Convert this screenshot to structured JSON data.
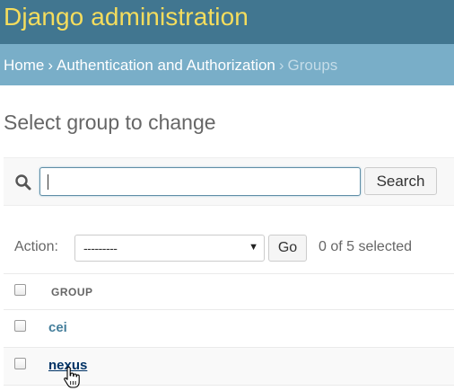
{
  "header": {
    "brand": "Django administration"
  },
  "breadcrumbs": {
    "items": [
      {
        "label": "Home",
        "link": true
      },
      {
        "label": "Authentication and Authorization",
        "link": true
      },
      {
        "label": "Groups",
        "link": false
      }
    ],
    "separator": "›"
  },
  "page": {
    "title": "Select group to change"
  },
  "search": {
    "value": "",
    "button_label": "Search",
    "icon": "search-icon"
  },
  "actions": {
    "label": "Action:",
    "selected_option": "---------",
    "go_label": "Go",
    "selected_count": "0 of 5 selected"
  },
  "results": {
    "column_header": "GROUP",
    "rows": [
      {
        "name": "cei"
      },
      {
        "name": "nexus"
      }
    ]
  },
  "colors": {
    "header_bg": "#417690",
    "brand": "#f5dd5d",
    "breadcrumbs_bg": "#79aec8",
    "link": "#447e9b"
  }
}
